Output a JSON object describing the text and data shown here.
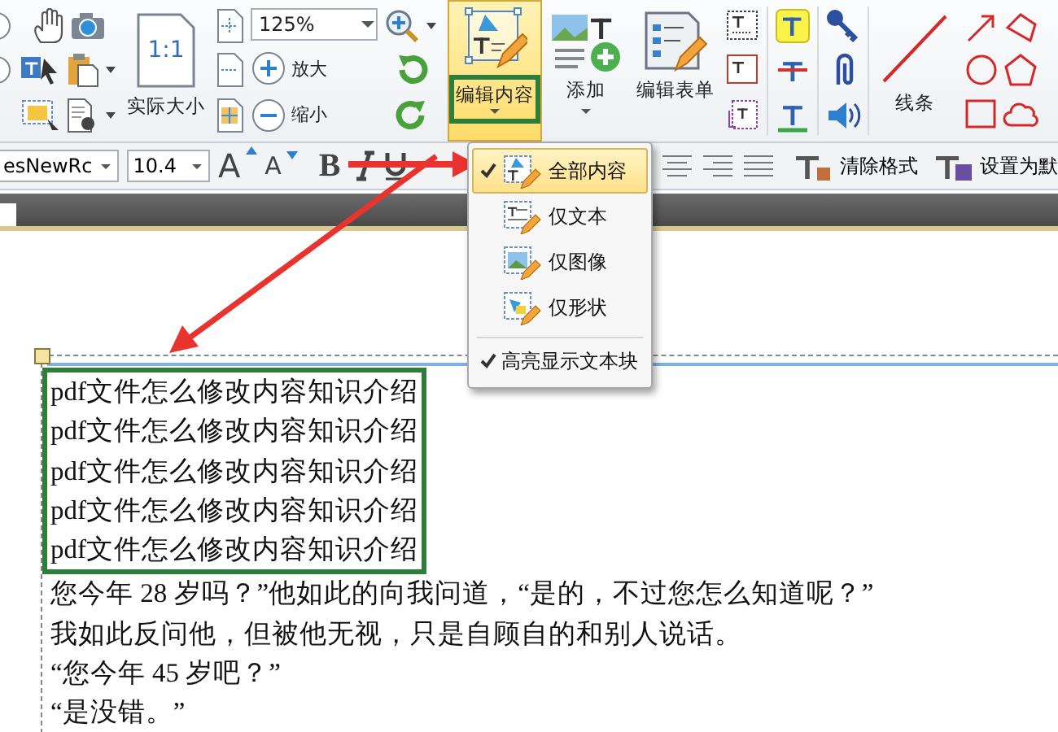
{
  "ribbon": {
    "actual_size_icon_text": "1:1",
    "zoom_field": {
      "value": "125%"
    },
    "actual_size": "实际大小",
    "zoom_in": "放大",
    "zoom_out": "缩小",
    "edit_content": {
      "label": "编辑内容",
      "pressed": true
    },
    "add": "添加",
    "edit_form": "编辑表单",
    "lines": "线条"
  },
  "format_bar": {
    "font_field": {
      "value": "esNewRc"
    },
    "size_field": {
      "value": "10.4"
    },
    "grow_font": "A",
    "shrink_font": "A",
    "bold": "B",
    "clear_format": "清除格式",
    "set_default": "设置为默"
  },
  "dropdown_menu": {
    "items": [
      {
        "label": "全部内容",
        "checked": true,
        "selected": true
      },
      {
        "label": "仅文本",
        "checked": false,
        "selected": false
      },
      {
        "label": "仅图像",
        "checked": false,
        "selected": false
      },
      {
        "label": "仅形状",
        "checked": false,
        "selected": false
      }
    ],
    "options": [
      {
        "label": "高亮显示文本块",
        "checked": true
      }
    ]
  },
  "document": {
    "selected_block": [
      "pdf文件怎么修改内容知识介绍",
      "pdf文件怎么修改内容知识介绍",
      "pdf文件怎么修改内容知识介绍",
      "pdf文件怎么修改内容知识介绍",
      "pdf文件怎么修改内容知识介绍"
    ],
    "lines": [
      "您今年 28 岁吗？”他如此的向我问道，“是的，不过您怎么知道呢？”",
      "我如此反问他，但被他无视，只是自顾自的和别人说话。",
      "“您今年 45 岁吧？”",
      "“是没错。”"
    ]
  }
}
